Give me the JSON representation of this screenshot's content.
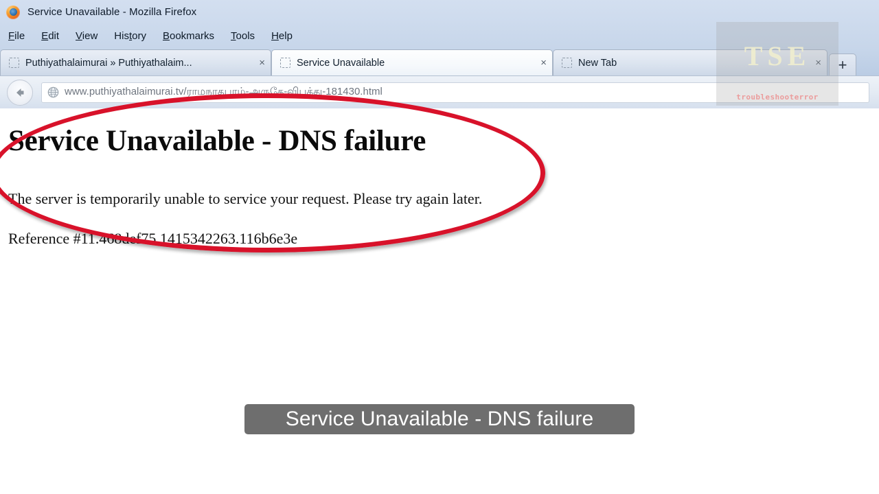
{
  "window": {
    "title": "Service Unavailable - Mozilla Firefox",
    "app_icon": "firefox-logo-icon"
  },
  "menubar": {
    "items": [
      {
        "label": "File",
        "accel": "F",
        "rest": "ile"
      },
      {
        "label": "Edit",
        "accel": "E",
        "rest": "dit"
      },
      {
        "label": "View",
        "accel": "V",
        "rest": "iew"
      },
      {
        "label": "History",
        "accel": "t",
        "pre": "His",
        "rest": "ory"
      },
      {
        "label": "Bookmarks",
        "accel": "B",
        "rest": "ookmarks"
      },
      {
        "label": "Tools",
        "accel": "T",
        "rest": "ools"
      },
      {
        "label": "Help",
        "accel": "H",
        "rest": "elp"
      }
    ]
  },
  "tabs": [
    {
      "label": "Puthiyathalaimurai » Puthiyathalaim...",
      "active": false,
      "close_label": "×",
      "favicon": "blank-favicon-icon"
    },
    {
      "label": "Service Unavailable",
      "active": true,
      "close_label": "×",
      "favicon": "blank-favicon-icon"
    },
    {
      "label": "New Tab",
      "active": false,
      "close_label": "×",
      "favicon": "blank-favicon-icon"
    }
  ],
  "newtab_button": {
    "label": "+"
  },
  "navbar": {
    "back_icon": "back-arrow-icon",
    "site_icon": "globe-icon",
    "url": "www.puthiyathalaimurai.tv/ராமநாதபுரம்-அருகே-விபத்து-181430.html"
  },
  "page": {
    "heading": "Service Unavailable - DNS failure",
    "body": "The server is temporarily unable to service your request. Please try again later.",
    "reference": "Reference #11.468def75.1415342263.116b6e3e"
  },
  "annotation": {
    "shape": "ellipse",
    "color": "#d8122a"
  },
  "watermark": {
    "text": "TSE",
    "subtext": "troubleshooterror"
  },
  "caption": {
    "text": "Service Unavailable - DNS failure",
    "background": "#6e6e6e",
    "color": "#ffffff"
  }
}
